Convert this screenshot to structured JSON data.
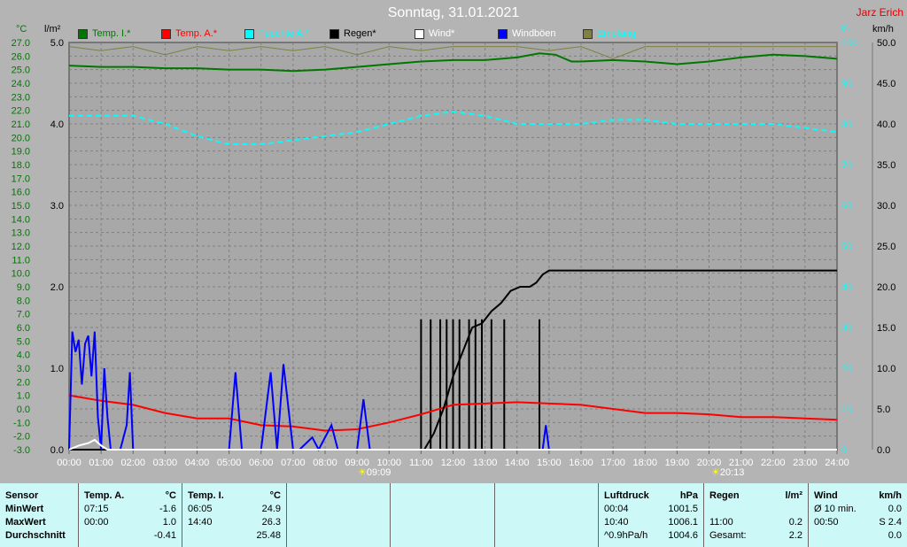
{
  "title": "Sonntag, 31.01.2021",
  "author": "Jarz Erich",
  "legend": [
    {
      "label": "Temp. I.*",
      "color": "#007800",
      "text": "#007800"
    },
    {
      "label": "Temp. A.*",
      "color": "#ff0000",
      "text": "#ff0000"
    },
    {
      "label": "Feuchte A.*",
      "color": "#00ffff",
      "text": "#00ffff"
    },
    {
      "label": "Regen*",
      "color": "#000000",
      "text": "#000000"
    },
    {
      "label": "Wind*",
      "color": "#ffffff",
      "text": "#ffffff"
    },
    {
      "label": "Windböen",
      "color": "#0000ff",
      "text": "#ffffff"
    },
    {
      "label": "Empfang",
      "color": "#808040",
      "text": "#00ffff"
    }
  ],
  "axis_units": {
    "temp": "°C",
    "rain": "l/m²",
    "hum": "%",
    "wind": "km/h"
  },
  "sun": {
    "rise": "09:09",
    "set": "20:13"
  },
  "chart_data": {
    "type": "line",
    "x_ticks": [
      "00:00",
      "01:00",
      "02:00",
      "03:00",
      "04:00",
      "05:00",
      "06:00",
      "07:00",
      "08:00",
      "09:00",
      "10:00",
      "11:00",
      "12:00",
      "13:00",
      "14:00",
      "15:00",
      "16:00",
      "17:00",
      "18:00",
      "19:00",
      "20:00",
      "21:00",
      "22:00",
      "23:00",
      "24:00"
    ],
    "xlim": [
      0,
      24
    ],
    "temp_ylim": [
      -3,
      27
    ],
    "rain_ylim": [
      0,
      5
    ],
    "hum_ylim": [
      0,
      100
    ],
    "wind_ylim": [
      0,
      50
    ],
    "temp_ticks": [
      "27.0",
      "26.0",
      "25.0",
      "24.0",
      "23.0",
      "22.0",
      "21.0",
      "20.0",
      "19.0",
      "18.0",
      "17.0",
      "16.0",
      "15.0",
      "14.0",
      "13.0",
      "12.0",
      "11.0",
      "10.0",
      "9.0",
      "8.0",
      "7.0",
      "6.0",
      "5.0",
      "4.0",
      "3.0",
      "2.0",
      "1.0",
      "0.0",
      "-1.0",
      "-2.0",
      "-3.0"
    ],
    "rain_ticks": [
      "5.0",
      "4.0",
      "3.0",
      "2.0",
      "1.0",
      "0.0"
    ],
    "hum_ticks": [
      "100",
      "90",
      "80",
      "70",
      "60",
      "50",
      "40",
      "30",
      "20",
      "10",
      "0"
    ],
    "wind_ticks": [
      "50.0",
      "45.0",
      "40.0",
      "35.0",
      "30.0",
      "25.0",
      "20.0",
      "15.0",
      "10.0",
      "5.0",
      "0.0"
    ],
    "series": [
      {
        "name": "Temp. I.",
        "axis": "temp",
        "color": "#007800",
        "x": [
          0,
          1,
          2,
          3,
          4,
          5,
          6,
          7,
          8,
          9,
          10,
          11,
          12,
          13,
          14,
          14.7,
          15.2,
          15.7,
          16,
          17,
          18,
          19,
          20,
          21,
          22,
          23,
          24
        ],
        "y": [
          25.3,
          25.2,
          25.2,
          25.1,
          25.1,
          25.0,
          25.0,
          24.9,
          25.0,
          25.2,
          25.4,
          25.6,
          25.7,
          25.7,
          25.9,
          26.2,
          26.1,
          25.6,
          25.6,
          25.7,
          25.6,
          25.4,
          25.6,
          25.9,
          26.1,
          26.0,
          25.8
        ]
      },
      {
        "name": "Temp. A.",
        "axis": "temp",
        "color": "#ff0000",
        "x": [
          0,
          1,
          2,
          3,
          4,
          5,
          6,
          7,
          8,
          9,
          10,
          11,
          12,
          13,
          14,
          15,
          16,
          17,
          18,
          19,
          20,
          21,
          22,
          23,
          24
        ],
        "y": [
          1.0,
          0.6,
          0.3,
          -0.3,
          -0.7,
          -0.7,
          -1.2,
          -1.3,
          -1.6,
          -1.5,
          -1.0,
          -0.4,
          0.3,
          0.4,
          0.5,
          0.4,
          0.3,
          0.0,
          -0.3,
          -0.3,
          -0.4,
          -0.6,
          -0.6,
          -0.7,
          -0.8
        ]
      },
      {
        "name": "Feuchte A.",
        "axis": "hum",
        "color": "#00ffff",
        "x": [
          0,
          1,
          2,
          3,
          4,
          5,
          6,
          7,
          8,
          9,
          10,
          11,
          12,
          13,
          14,
          15,
          16,
          17,
          18,
          19,
          20,
          21,
          22,
          23,
          24
        ],
        "y": [
          82,
          82,
          82,
          80,
          77,
          75,
          75,
          76,
          77,
          78,
          80,
          82,
          83,
          82,
          80,
          80,
          80,
          81,
          81,
          80,
          80,
          80,
          80,
          79,
          78
        ]
      },
      {
        "name": "Regen",
        "axis": "rain",
        "color": "#000000",
        "x": [
          0,
          11.1,
          11.4,
          11.7,
          12,
          12.3,
          12.6,
          12.9,
          13.2,
          13.5,
          13.8,
          14.1,
          14.4,
          14.6,
          14.8,
          15,
          16,
          24
        ],
        "y": [
          0,
          0,
          0.2,
          0.5,
          0.9,
          1.2,
          1.5,
          1.55,
          1.7,
          1.8,
          1.95,
          2.0,
          2.0,
          2.05,
          2.15,
          2.2,
          2.2,
          2.2
        ]
      },
      {
        "name": "Windböen",
        "axis": "wind",
        "color": "#0000ff",
        "x": [
          0,
          0.1,
          0.2,
          0.3,
          0.4,
          0.5,
          0.6,
          0.7,
          0.8,
          0.9,
          1,
          1.1,
          1.2,
          1.3,
          1.6,
          1.8,
          1.9,
          2,
          5.0,
          5.2,
          5.4,
          5.6,
          6.0,
          6.3,
          6.5,
          6.7,
          7.0,
          7.2,
          7.6,
          7.8,
          8.2,
          8.4,
          9.0,
          9.2,
          9.4,
          14.8,
          14.9,
          15.0
        ],
        "y": [
          0,
          14.5,
          12,
          13.5,
          8,
          13,
          14,
          9,
          14.5,
          4,
          0,
          10,
          4,
          0,
          0,
          3,
          9.5,
          0,
          0,
          9.5,
          0,
          0,
          0,
          9.5,
          0,
          10.5,
          0,
          0,
          1.5,
          0,
          3,
          0,
          0,
          6.2,
          0,
          0,
          3,
          0
        ]
      },
      {
        "name": "Wind",
        "axis": "wind",
        "color": "#ffffff",
        "x": [
          0,
          0.3,
          0.6,
          0.8,
          1,
          1.2,
          24
        ],
        "y": [
          0,
          0.5,
          0.8,
          1.2,
          0.5,
          0,
          0
        ]
      },
      {
        "name": "Empfang",
        "axis": "hum",
        "color": "#808040",
        "x": [
          0,
          1,
          2,
          3,
          4,
          5,
          6,
          7,
          8,
          9,
          10,
          11,
          12,
          13,
          14,
          15,
          16,
          17,
          18,
          19,
          20,
          21,
          22,
          23,
          24
        ],
        "y": [
          99,
          98,
          99,
          97,
          99,
          98,
          99,
          98,
          99,
          97,
          99,
          98,
          99,
          99,
          99,
          98,
          99,
          96,
          99,
          99,
          99,
          99,
          99,
          99,
          99
        ]
      }
    ],
    "rain_bars": {
      "x": [
        11.0,
        11.3,
        11.6,
        11.8,
        12.0,
        12.2,
        12.5,
        12.7,
        12.9,
        13.2,
        13.6,
        14.7
      ],
      "y": [
        0.2,
        0.2,
        0.2,
        0.2,
        0.2,
        0.2,
        0.2,
        0.2,
        0.2,
        0.2,
        0.2,
        0.2
      ]
    }
  },
  "table": {
    "temp_a": {
      "head": "Temp. A.",
      "unit": "°C",
      "min_t": "07:15",
      "min": "-1.6",
      "max_t": "00:00",
      "max": "1.0",
      "avg": "-0.41"
    },
    "temp_i": {
      "head": "Temp. I.",
      "unit": "°C",
      "min_t": "06:05",
      "min": "24.9",
      "max_t": "14:40",
      "max": "26.3",
      "avg": "25.48"
    },
    "sensor": {
      "head": "Sensor",
      "min": "MinWert",
      "max": "MaxWert",
      "avg": "Durchschnitt"
    },
    "press": {
      "head": "Luftdruck",
      "unit": "hPa",
      "min_t": "00:04",
      "min": "1001.5",
      "max_t": "10:40",
      "max": "1006.1",
      "trend": "^0.9hPa/h",
      "avg": "1004.6"
    },
    "rain": {
      "head": "Regen",
      "unit": "l/m²",
      "max_t": "11:00",
      "max": "0.2",
      "total_label": "Gesamt:",
      "total": "2.2"
    },
    "wind": {
      "head": "Wind",
      "unit": "km/h",
      "avg_label": "Ø 10 min.",
      "avg": "0.0",
      "max_t": "00:50",
      "max": "S 2.4",
      "last": "0.0"
    }
  }
}
